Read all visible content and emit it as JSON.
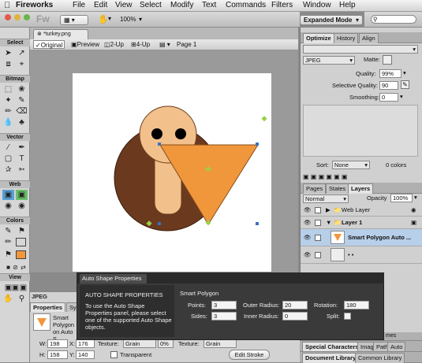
{
  "menubar": {
    "apple": "",
    "items": [
      "Fireworks",
      "File",
      "Edit",
      "View",
      "Select",
      "Modify",
      "Text",
      "Commands",
      "Filters",
      "Window",
      "Help"
    ]
  },
  "toolbar": {
    "logo": "Fw",
    "zoom": "100%",
    "workspace": "Expanded Mode"
  },
  "tools": {
    "sections": [
      "Select",
      "Bitmap",
      "Vector",
      "Web",
      "Colors",
      "View"
    ]
  },
  "document": {
    "tab": "*turkey.png",
    "views": [
      "Original",
      "Preview",
      "2-Up",
      "4-Up"
    ],
    "page": "Page 1"
  },
  "optimize": {
    "tabs": [
      "Optimize",
      "History",
      "Align"
    ],
    "format": "JPEG",
    "matte_label": "Matte:",
    "quality_label": "Quality:",
    "quality": "99%",
    "selective_label": "Selective Quality:",
    "selective": "90",
    "smoothing_label": "Smoothing:",
    "smoothing": "0",
    "sort_label": "Sort:",
    "sort": "None",
    "colors": "0 colors"
  },
  "layers": {
    "tabs": [
      "Pages",
      "States",
      "Layers"
    ],
    "blend": "Normal",
    "opacity_label": "Opacity",
    "opacity": "100%",
    "rows": [
      "Web Layer",
      "Layer 1",
      "Smart Polygon Auto ...",
      "• •"
    ]
  },
  "auto_shape": {
    "tab": "Auto Shape Properties",
    "heading": "AUTO SHAPE PROPERTIES",
    "description": "To use the Auto Shape Properties panel, please select one of the supported Auto Shape objects.",
    "shape_name": "Smart Polygon",
    "points_label": "Points:",
    "points": "3",
    "sides_label": "Sides:",
    "sides": "3",
    "outer_label": "Outer Radius:",
    "outer": "20",
    "inner_label": "Inner Radius:",
    "inner": "0",
    "rotation_label": "Rotation:",
    "rotation": "180",
    "split_label": "Split:"
  },
  "properties": {
    "doc_label": "JPEG (Document)",
    "tabs": [
      "Properties",
      "Sym"
    ],
    "object_name": "Smart Polygon on Auto S",
    "w_label": "W:",
    "w": "198",
    "x_label": "X:",
    "x": "176",
    "h_label": "H:",
    "h": "158",
    "y_label": "Y:",
    "y": "140",
    "texture_label": "Texture:",
    "texture": "Grain",
    "texture_pct": "0%",
    "texture2_label": "Texture:",
    "texture2": "Grain",
    "transparent_label": "Transparent",
    "edit_stroke": "Edit Stroke"
  },
  "bottom_panels": {
    "row1": [
      "Special Characters",
      "Imag",
      "Path",
      "Auto"
    ],
    "row2": [
      "Document Library",
      "Common Library"
    ],
    "partial": "mes"
  },
  "colors": {
    "turkey_body": "#6b3a1e",
    "turkey_head": "#f2c08a",
    "polygon": "#f0973c",
    "selection": "#b7cfe8"
  }
}
